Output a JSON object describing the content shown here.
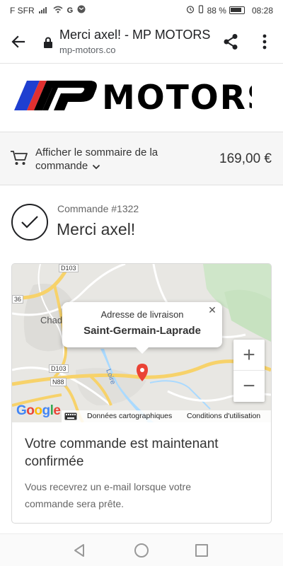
{
  "status_bar": {
    "carrier": "F SFR",
    "battery_percent": "88 %",
    "time": "08:28"
  },
  "browser": {
    "page_title": "Merci axel! - MP MOTORS",
    "url": "mp-motors.co"
  },
  "header": {
    "logo_text": "MOTORS",
    "brand_colors": [
      "#1f3fd0",
      "#e03030",
      "#000000"
    ]
  },
  "summary": {
    "label": "Afficher le sommaire de la commande",
    "price": "169,00 €"
  },
  "order": {
    "number": "Commande #1322",
    "thanks": "Merci axel!"
  },
  "map": {
    "popup_title": "Adresse de livraison",
    "popup_place": "Saint-Germain-Laprade",
    "zoom_in": "+",
    "zoom_out": "−",
    "labels": {
      "d103_top": "D103",
      "r36": "36",
      "city": "Chad",
      "d103": "D103",
      "n88": "N88",
      "river": "Loire"
    },
    "data_link": "Données cartographiques",
    "terms_link": "Conditions d'utilisation",
    "google": [
      "G",
      "o",
      "o",
      "g",
      "l",
      "e"
    ]
  },
  "confirmation": {
    "title": "Votre commande est maintenant confirmée",
    "text": "Vous recevrez un e-mail lorsque votre commande sera prête."
  }
}
